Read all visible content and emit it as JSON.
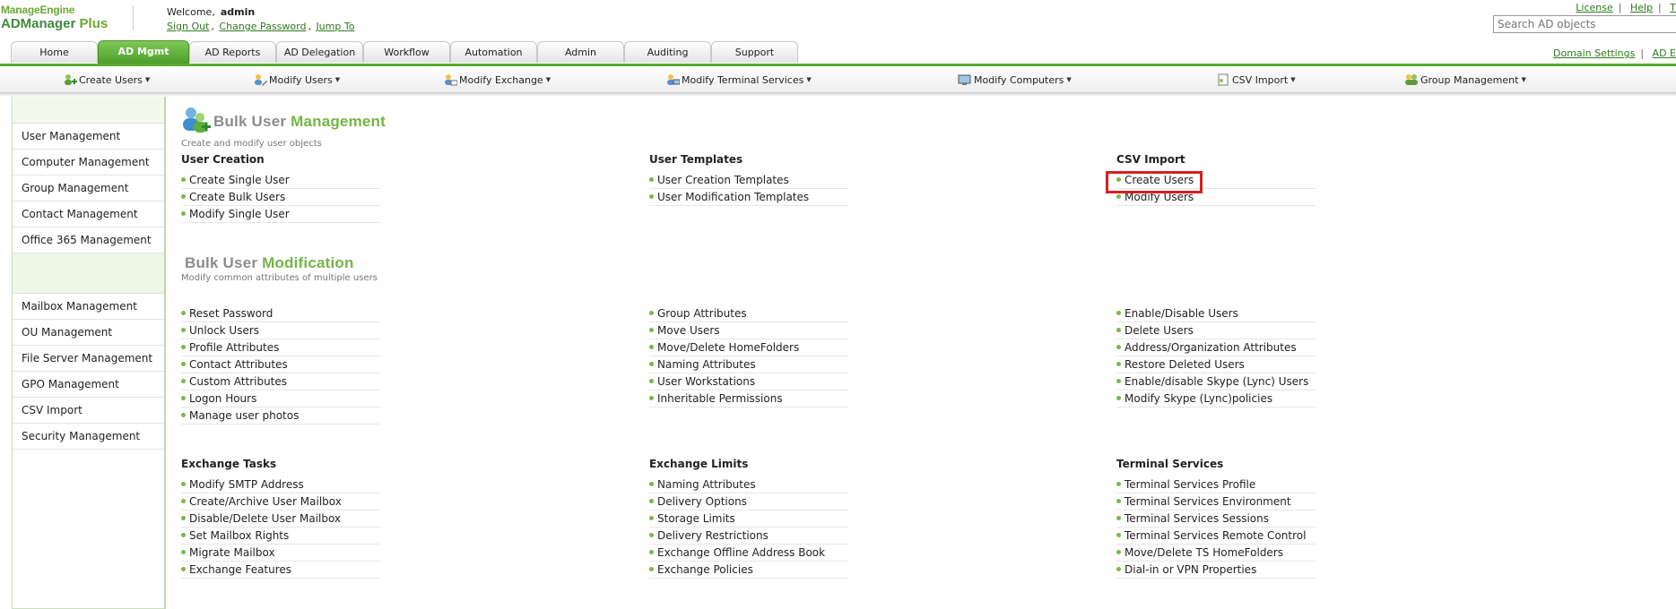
{
  "header": {
    "brand_top": "ManageEngine",
    "brand_product_1": "ADManager",
    "brand_product_2": " Plus",
    "welcome_label": "Welcome,",
    "username": "admin",
    "links": [
      "Sign Out",
      "Change Password",
      "Jump To"
    ],
    "top_links": [
      "License",
      "Help",
      "T"
    ],
    "search_placeholder": "Search AD objects",
    "right_links": [
      "Domain Settings",
      "AD E"
    ]
  },
  "tabs": [
    "Home",
    "AD Mgmt",
    "AD Reports",
    "AD Delegation",
    "Workflow",
    "Automation",
    "Admin",
    "Auditing",
    "Support"
  ],
  "active_tab": "AD Mgmt",
  "submenu": [
    "Create Users",
    "Modify Users",
    "Modify Exchange",
    "Modify Terminal Services",
    "Modify Computers",
    "CSV Import",
    "Group Management"
  ],
  "sidebar": {
    "group1": [
      "User Management",
      "Computer Management",
      "Group Management",
      "Contact Management",
      "Office 365 Management"
    ],
    "group2": [
      "Mailbox Management",
      "OU Management",
      "File Server Management",
      "GPO Management",
      "CSV Import",
      "Security Management"
    ]
  },
  "bulk_mgmt": {
    "title_1": "Bulk User ",
    "title_2": "Management",
    "description": "Create and modify user objects",
    "columns": [
      {
        "title": "User Creation",
        "items": [
          "Create Single User",
          "Create Bulk Users",
          "Modify Single User"
        ]
      },
      {
        "title": "User Templates",
        "items": [
          "User Creation Templates",
          "User Modification Templates"
        ]
      },
      {
        "title": "CSV Import",
        "items": [
          "Create Users",
          "Modify Users"
        ]
      }
    ]
  },
  "bulk_mod": {
    "title_1": "Bulk User ",
    "title_2": "Modification",
    "description": "Modify common attributes of multiple users",
    "columns": [
      {
        "items": [
          "Reset Password",
          "Unlock Users",
          "Profile Attributes",
          "Contact Attributes",
          "Custom Attributes",
          "Logon Hours",
          "Manage user photos"
        ]
      },
      {
        "items": [
          "Group Attributes",
          "Move Users",
          "Move/Delete HomeFolders",
          "Naming Attributes",
          "User Workstations",
          "Inheritable Permissions"
        ]
      },
      {
        "items": [
          "Enable/Disable Users",
          "Delete Users",
          "Address/Organization Attributes",
          "Restore Deleted Users",
          "Enable/disable Skype (Lync) Users",
          "Modify Skype (Lync)policies"
        ]
      }
    ]
  },
  "bottom": {
    "columns": [
      {
        "title": "Exchange Tasks",
        "items": [
          "Modify SMTP Address",
          "Create/Archive User Mailbox",
          "Disable/Delete User Mailbox",
          "Set Mailbox Rights",
          "Migrate Mailbox",
          "Exchange Features"
        ]
      },
      {
        "title": "Exchange Limits",
        "items": [
          "Naming Attributes",
          "Delivery Options",
          "Storage Limits",
          "Delivery Restrictions",
          "Exchange Offline Address Book",
          "Exchange Policies"
        ]
      },
      {
        "title": "Terminal Services",
        "items": [
          "Terminal Services Profile",
          "Terminal Services Environment",
          "Terminal Services Sessions",
          "Terminal Services Remote Control",
          "Move/Delete TS HomeFolders",
          "Dial-in or VPN Properties"
        ]
      }
    ]
  },
  "colors": {
    "accent_green": "#5aac2f",
    "highlight_red": "#d6201f",
    "bullet_green": "#7ab848"
  }
}
